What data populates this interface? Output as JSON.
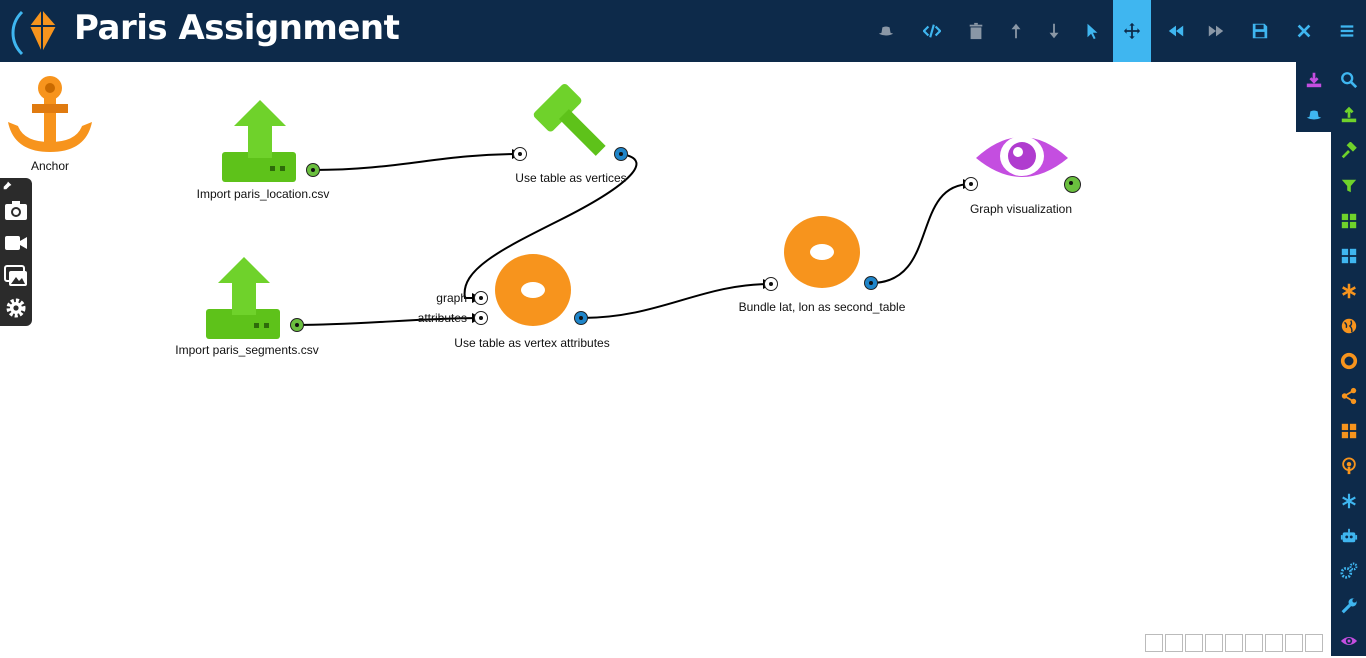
{
  "header": {
    "title": "Paris Assignment"
  },
  "toolbar": {
    "icons": [
      "hat-icon",
      "code-icon",
      "trash-icon",
      "arrow-up-icon",
      "arrow-down-icon",
      "pointer-icon",
      "move-icon",
      "rewind-icon",
      "fast-forward-icon",
      "save-icon",
      "close-icon",
      "menu-icon"
    ],
    "active": "move-icon",
    "color_inactive": "#3fb6f0",
    "color_disabled": "#8a97a6"
  },
  "sidebar": {
    "flyout_icons": [
      "download-icon",
      "search-icon",
      "hat-icon",
      "upload-icon"
    ],
    "icons": [
      "hammer-icon",
      "filter-icon",
      "grid-icon",
      "grid-icon",
      "asterisk-icon",
      "globe-icon",
      "circle-icon",
      "share-icon",
      "th-large-icon",
      "podcast-icon",
      "snowflake-icon",
      "robot-icon",
      "gears-icon",
      "wrench-icon",
      "eye-icon"
    ]
  },
  "left_tools": {
    "icons": [
      "pin-icon",
      "camera-icon",
      "video-icon",
      "images-icon",
      "gear-icon"
    ]
  },
  "boxes": {
    "anchor": {
      "label": "Anchor"
    },
    "import_location": {
      "label": "Import paris_location.csv"
    },
    "import_segments": {
      "label": "Import paris_segments.csv"
    },
    "use_table_vertices": {
      "label": "Use table as vertices"
    },
    "use_table_attrs": {
      "label": "Use table as vertex attributes",
      "input_graph": "graph",
      "input_attributes": "attributes"
    },
    "bundle": {
      "label": "Bundle lat, lon as second_table"
    },
    "graph_vis": {
      "label": "Graph visualization"
    }
  },
  "colors": {
    "header_bg": "#0d2a4a",
    "green": "#6fd22b",
    "orange": "#f7941d",
    "purple": "#c44ee0",
    "blue_plug": "#1f85c9",
    "green_plug": "#6abf3e"
  },
  "pager": {
    "count": 9
  }
}
